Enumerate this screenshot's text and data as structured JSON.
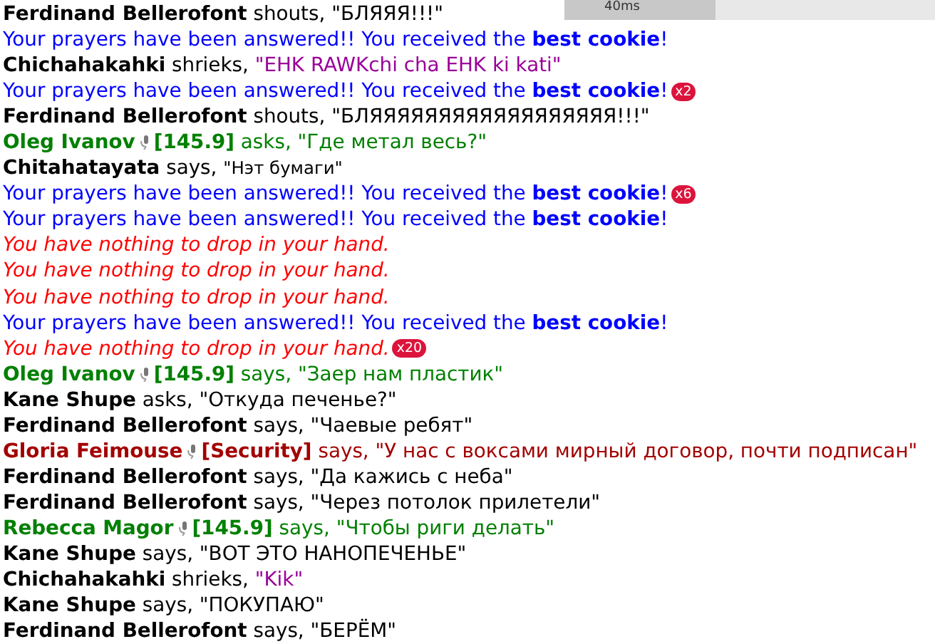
{
  "ping": "40ms",
  "messages": [
    {
      "kind": "speech",
      "speaker": "Ferdinand Bellerofont",
      "verb": "shouts,",
      "quote": "\"БЛЯЯЯ!!!\"",
      "color": "#000000"
    },
    {
      "kind": "notice",
      "text": "Your prayers have been answered!! You received the **best cookie**!",
      "color": "#0000ff"
    },
    {
      "kind": "shriek",
      "speaker": "Chichahakahki",
      "verb": "shrieks,",
      "quote": "\"EHK RAWKchi cha EHK ki kati\"",
      "color": "#000000"
    },
    {
      "kind": "notice",
      "text": "Your prayers have been answered!! You received the **best cookie**!",
      "color": "#0000ff",
      "count": "x2"
    },
    {
      "kind": "speech",
      "speaker": "Ferdinand Bellerofont",
      "verb": "shouts,",
      "quote": "\"БЛЯЯЯЯЯЯЯЯЯЯЯЯЯЯЯЯЯЯ!!!\"",
      "color": "#000000"
    },
    {
      "kind": "radio",
      "speaker": "Oleg Ivanov",
      "channel": "[145.9]",
      "verb": "asks,",
      "quote": "\"Где метал весь?\"",
      "color": "#008000"
    },
    {
      "kind": "speech",
      "speaker": "Chitahatayata",
      "verb": "says,",
      "quote": "\"Нэт бумаги\"",
      "color": "#000000",
      "quote_small": true
    },
    {
      "kind": "notice",
      "text": "Your prayers have been answered!! You received the **best cookie**!",
      "color": "#0000ff",
      "count": "x6"
    },
    {
      "kind": "notice",
      "text": "Your prayers have been answered!! You received the **best cookie**!",
      "color": "#0000ff"
    },
    {
      "kind": "warning",
      "text": "You have nothing to drop in your hand.",
      "color": "#ff0000"
    },
    {
      "kind": "warning",
      "text": "You have nothing to drop in your hand.",
      "color": "#ff0000"
    },
    {
      "kind": "warning",
      "text": "You have nothing to drop in your hand.",
      "color": "#ff0000"
    },
    {
      "kind": "notice",
      "text": "Your prayers have been answered!! You received the **best cookie**!",
      "color": "#0000ff"
    },
    {
      "kind": "warning",
      "text": "You have nothing to drop in your hand.",
      "color": "#ff0000",
      "count": "x20"
    },
    {
      "kind": "radio",
      "speaker": "Oleg Ivanov",
      "channel": "[145.9]",
      "verb": "says,",
      "quote": "\"Заер нам пластик\"",
      "color": "#008000"
    },
    {
      "kind": "speech",
      "speaker": "Kane Shupe",
      "verb": "asks,",
      "quote": "\"Откуда печенье?\"",
      "color": "#000000"
    },
    {
      "kind": "speech",
      "speaker": "Ferdinand Bellerofont",
      "verb": "says,",
      "quote": "\"Чаевые ребят\"",
      "color": "#000000"
    },
    {
      "kind": "radio",
      "speaker": "Gloria Feimouse",
      "channel": "[Security]",
      "verb": "says,",
      "quote": "\"У нас с воксами мирный договор, почти подписан\"",
      "color": "#a30000"
    },
    {
      "kind": "speech",
      "speaker": "Ferdinand Bellerofont",
      "verb": "says,",
      "quote": "\"Да кажись с неба\"",
      "color": "#000000"
    },
    {
      "kind": "speech",
      "speaker": "Ferdinand Bellerofont",
      "verb": "says,",
      "quote": "\"Через потолок прилетели\"",
      "color": "#000000"
    },
    {
      "kind": "radio",
      "speaker": "Rebecca Magor",
      "channel": "[145.9]",
      "verb": "says,",
      "quote": "\"Чтобы риги делать\"",
      "color": "#008000"
    },
    {
      "kind": "speech",
      "speaker": "Kane Shupe",
      "verb": "says,",
      "quote": "\"ВОТ ЭТО НАНОПЕЧЕНЬЕ\"",
      "color": "#000000"
    },
    {
      "kind": "shriek",
      "speaker": "Chichahakahki",
      "verb": "shrieks,",
      "quote": "\"Kik\"",
      "color": "#000000"
    },
    {
      "kind": "speech",
      "speaker": "Kane Shupe",
      "verb": "says,",
      "quote": "\"ПОКУПАЮ\"",
      "color": "#000000"
    },
    {
      "kind": "speech",
      "speaker": "Ferdinand Bellerofont",
      "verb": "says,",
      "quote": "\"БЕРЁМ\"",
      "color": "#000000"
    }
  ]
}
